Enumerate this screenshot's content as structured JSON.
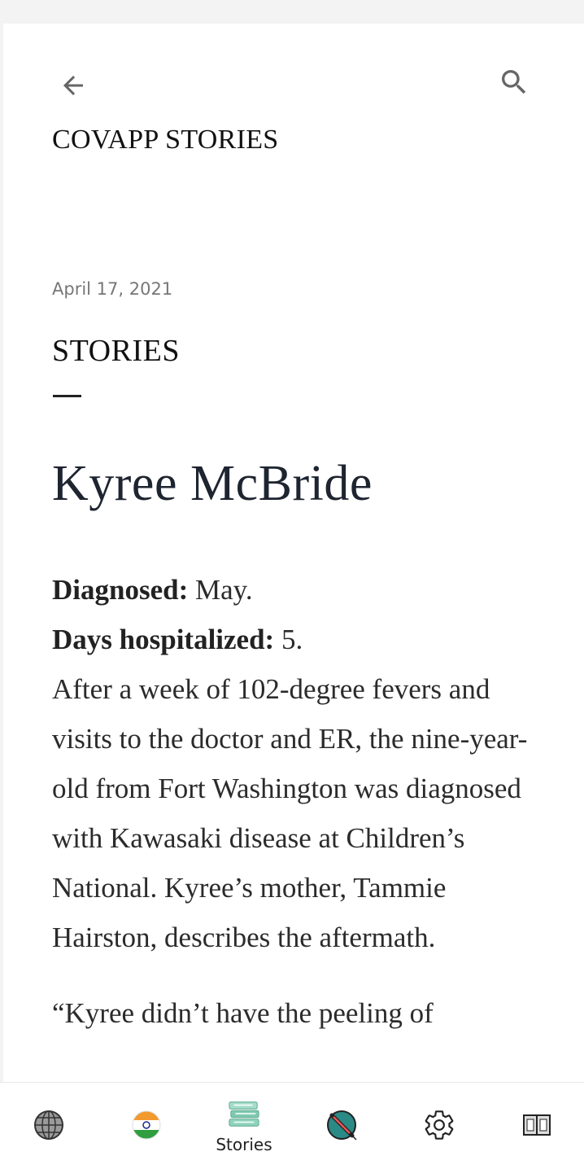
{
  "header": {
    "blog_title": "COVAPP STORIES"
  },
  "post": {
    "date": "April 17, 2021",
    "label": "STORIES",
    "title": "Kyree McBride",
    "diagnosed_label": "Diagnosed:",
    "diagnosed_value": " May.",
    "days_label": "Days hospitalized:",
    "days_value": " 5.",
    "intro": "After a week of 102-degree fevers and visits to the doctor and ER, the nine-year-old from Fort Washington was diagnosed with Kawasaki disease at Children’s National. Kyree’s mother, Tammie Hairston, describes the aftermath.",
    "quote_start": "“Kyree didn’t have the peeling of"
  },
  "bottom_nav": {
    "items": [
      {
        "icon": "globe-icon",
        "label": ""
      },
      {
        "icon": "india-flag-icon",
        "label": ""
      },
      {
        "icon": "books-icon",
        "label": "Stories",
        "active": true
      },
      {
        "icon": "vaccine-icon",
        "label": ""
      },
      {
        "icon": "gear-icon",
        "label": ""
      },
      {
        "icon": "book-open-icon",
        "label": ""
      }
    ]
  },
  "colors": {
    "background": "#f3f3f3",
    "card": "#ffffff",
    "text": "#222222",
    "date": "#777777",
    "india_saffron": "#f29a2e",
    "india_green": "#2f9e3f",
    "books_teal": "#7fc9b0",
    "vaccine_teal": "#2a8a86"
  }
}
